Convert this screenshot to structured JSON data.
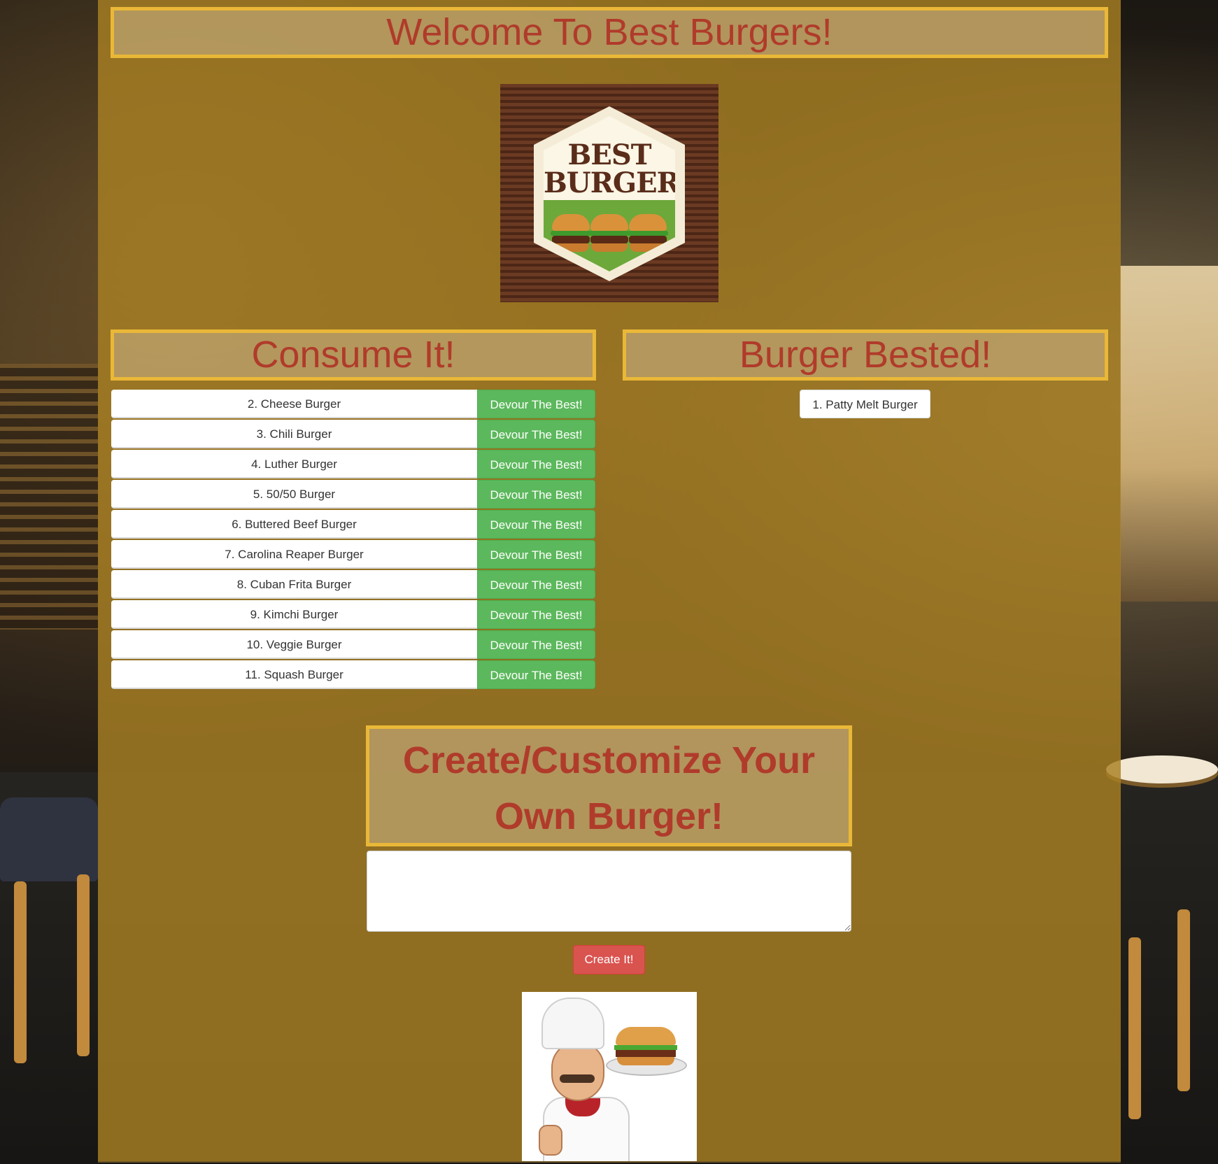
{
  "header": {
    "title": "Welcome To Best Burgers!"
  },
  "logo": {
    "text_line1": "BEST",
    "text_line2": "BURGERS"
  },
  "consume": {
    "title": "Consume It!",
    "button_label": "Devour The Best!",
    "items": [
      "2. Cheese Burger",
      "3. Chili Burger",
      "4. Luther Burger",
      "5. 50/50 Burger",
      "6. Buttered Beef Burger",
      "7. Carolina Reaper Burger",
      "8. Cuban Frita Burger",
      "9. Kimchi Burger",
      "10. Veggie Burger",
      "11. Squash Burger"
    ]
  },
  "bested": {
    "title": "Burger Bested!",
    "items": [
      "1. Patty Melt Burger"
    ]
  },
  "create": {
    "title": "Create/Customize Your Own Burger!",
    "input_value": "",
    "button_label": "Create It!"
  },
  "colors": {
    "panel": "#a88023",
    "frame_border": "#eab838",
    "heading_text": "#b03b2b",
    "devour_button": "#5cb85c",
    "create_button": "#d9534f"
  }
}
